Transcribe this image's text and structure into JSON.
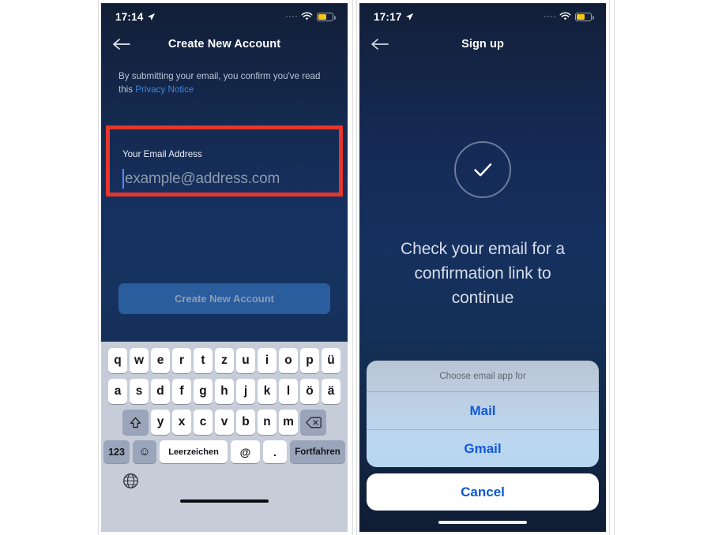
{
  "page": {
    "background": "#ffffff"
  },
  "colors": {
    "screen_navy": "#16305f",
    "screen_navy_dark": "#111e36",
    "highlight_red": "#e8352b",
    "link_blue": "#3d84de",
    "cta_blue": "#2a5d9e",
    "cta_text": "#8d9db4",
    "sheet_action_blue": "#1359d8",
    "keyboard_bg": "#c7ccd9",
    "key_white": "#ffffff",
    "key_grey": "#9aa4ba",
    "battery_yellow": "#f5c518"
  },
  "left_screen": {
    "status_bar": {
      "time": "17:14",
      "location_icon": "location-arrow-icon",
      "signal_icon": "signal-dots-icon",
      "wifi_icon": "wifi-icon",
      "battery_icon": "battery-low-power-icon"
    },
    "nav": {
      "back_icon": "arrow-left-icon",
      "title": "Create New Account"
    },
    "consent": {
      "text_before": "By submitting your email, you confirm you've read this ",
      "link_label": "Privacy Notice"
    },
    "email_field": {
      "label": "Your Email Address",
      "value": "",
      "placeholder": "example@address.com",
      "highlighted": true,
      "caret_visible": true
    },
    "cta": {
      "label": "Create New Account",
      "enabled": false
    },
    "keyboard": {
      "layout": "QWERTZ (German)",
      "row1": [
        "q",
        "w",
        "e",
        "r",
        "t",
        "z",
        "u",
        "i",
        "o",
        "p",
        "ü"
      ],
      "row2": [
        "a",
        "s",
        "d",
        "f",
        "g",
        "h",
        "j",
        "k",
        "l",
        "ö",
        "ä"
      ],
      "row3_letters": [
        "y",
        "x",
        "c",
        "v",
        "b",
        "n",
        "m"
      ],
      "shift_icon": "shift-arrow-up-icon",
      "backspace_icon": "backspace-delete-icon",
      "numbers_key": "123",
      "emoji_icon": "smiley-face-icon",
      "space_key": "Leerzeichen",
      "at_key": "@",
      "dot_key": ".",
      "go_key": "Fortfahren",
      "globe_icon": "globe-language-icon",
      "home_indicator": "home-indicator-bar"
    }
  },
  "right_screen": {
    "status_bar": {
      "time": "17:17",
      "location_icon": "location-arrow-icon",
      "signal_icon": "signal-dots-icon",
      "wifi_icon": "wifi-icon",
      "battery_icon": "battery-low-power-icon"
    },
    "nav": {
      "back_icon": "arrow-left-icon",
      "title": "Sign up"
    },
    "success": {
      "check_icon": "checkmark-circle-icon",
      "message": "Check your email for a confirmation link to continue"
    },
    "action_sheet": {
      "title": "Choose email app for",
      "options": [
        {
          "label": "Mail"
        },
        {
          "label": "Gmail"
        }
      ],
      "cancel_label": "Cancel"
    },
    "home_indicator": "home-indicator-bar"
  }
}
